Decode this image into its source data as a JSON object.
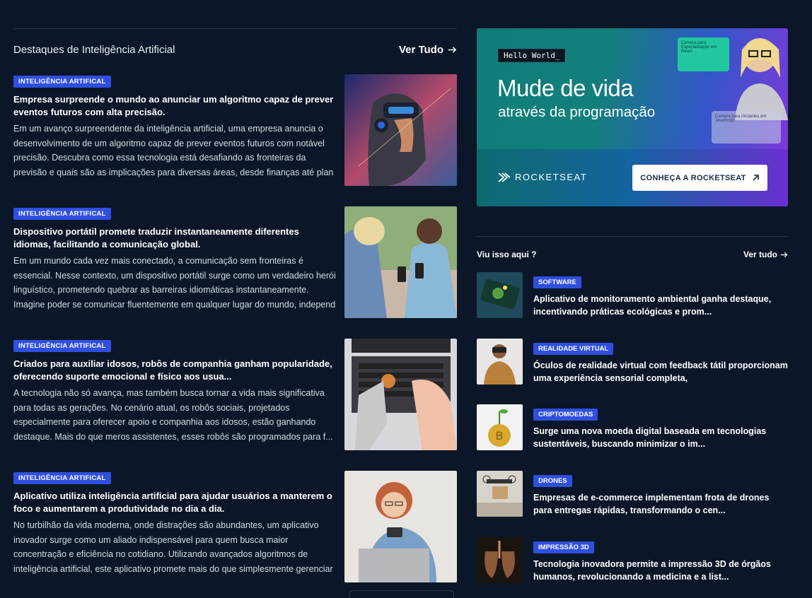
{
  "left_section": {
    "title": "Destaques de Inteligência Artificial",
    "see_all": "Ver Tudo"
  },
  "articles": [
    {
      "badge": "INTELIGÊNCIA ARTIFICAL",
      "title": "Empresa surpreende o mundo ao anunciar um algoritmo capaz de prever eventos futuros com alta precisão.",
      "desc": "Em um avanço surpreendente da inteligência artificial, uma empresa anuncia o desenvolvimento de um algoritmo capaz de prever eventos futuros com notável precisão. Descubra como essa tecnologia está desafiando as fronteiras da previsão e quais são as implicações para diversas áreas, desde finanças até plan"
    },
    {
      "badge": "INTELIGÊNCIA ARTIFICAL",
      "title": "Dispositivo portátil promete traduzir instantaneamente diferentes idiomas, facilitando a comunicação global.",
      "desc": "Em um mundo cada vez mais conectado, a comunicação sem fronteiras é essencial. Nesse contexto, um dispositivo portátil surge como um verdadeiro herói linguístico, prometendo quebrar as barreiras idiomáticas instantaneamente. Imagine poder se comunicar fluentemente em qualquer lugar do mundo, independ"
    },
    {
      "badge": "INTELIGÊNCIA ARTIFICAL",
      "title": "Criados para auxiliar idosos, robôs de companhia ganham popularidade, oferecendo suporte emocional e físico aos usua...",
      "desc": "A tecnologia não só avança, mas também busca tornar a vida mais significativa para todas as gerações. No cenário atual, os robôs sociais, projetados especialmente para oferecer apoio e companhia aos idosos, estão ganhando destaque. Mais do que meros assistentes, esses robôs são programados para f..."
    },
    {
      "badge": "INTELIGÊNCIA ARTIFICAL",
      "title": "Aplicativo utiliza inteligência artificial para ajudar usuários a manterem o foco e aumentarem a produtividade no dia a dia.",
      "desc": "No turbilhão da vida moderna, onde distrações são abundantes, um aplicativo inovador surge como um aliado indispensável para quem busca maior concentração e eficiência no cotidiano. Utilizando avançados algoritmos de inteligência artificial, este aplicativo promete mais do que simplesmente gerenciar"
    }
  ],
  "banner": {
    "hello": "Hello World_",
    "headline": "Mude de vida",
    "subheadline": "através da programação",
    "brand": "ROCKETSEAT",
    "cta": "CONHEÇA A ROCKETSEAT",
    "card_a": "Carreira para Especialização em React",
    "card_b": "Carreira para Iniciantes em JavaScript"
  },
  "right_section": {
    "title": "Viu isso aqui ?",
    "see_all": "Ver tudo"
  },
  "side_items": [
    {
      "badge": "SOFTWARE",
      "title": "Aplicativo de monitoramento ambiental ganha destaque, incentivando práticas ecológicas e prom..."
    },
    {
      "badge": "REALIDADE VIRTUAL",
      "title": "Óculos de realidade virtual com feedback tátil proporcionam uma experiência sensorial completa,"
    },
    {
      "badge": "CRIPTOMOEDAS",
      "title": "Surge uma nova moeda digital baseada em tecnologias sustentáveis, buscando minimizar o im..."
    },
    {
      "badge": "DRONES",
      "title": "Empresas de e-commerce implementam frota de drones para entregas rápidas, transformando o cen..."
    },
    {
      "badge": "IMPRESSÃO 3D",
      "title": "Tecnologia inovadora permite a impressão 3D de órgãos humanos, revolucionando a medicina e a list..."
    }
  ],
  "colors": {
    "background": "#0b1728",
    "badge": "#2f4fe0"
  }
}
